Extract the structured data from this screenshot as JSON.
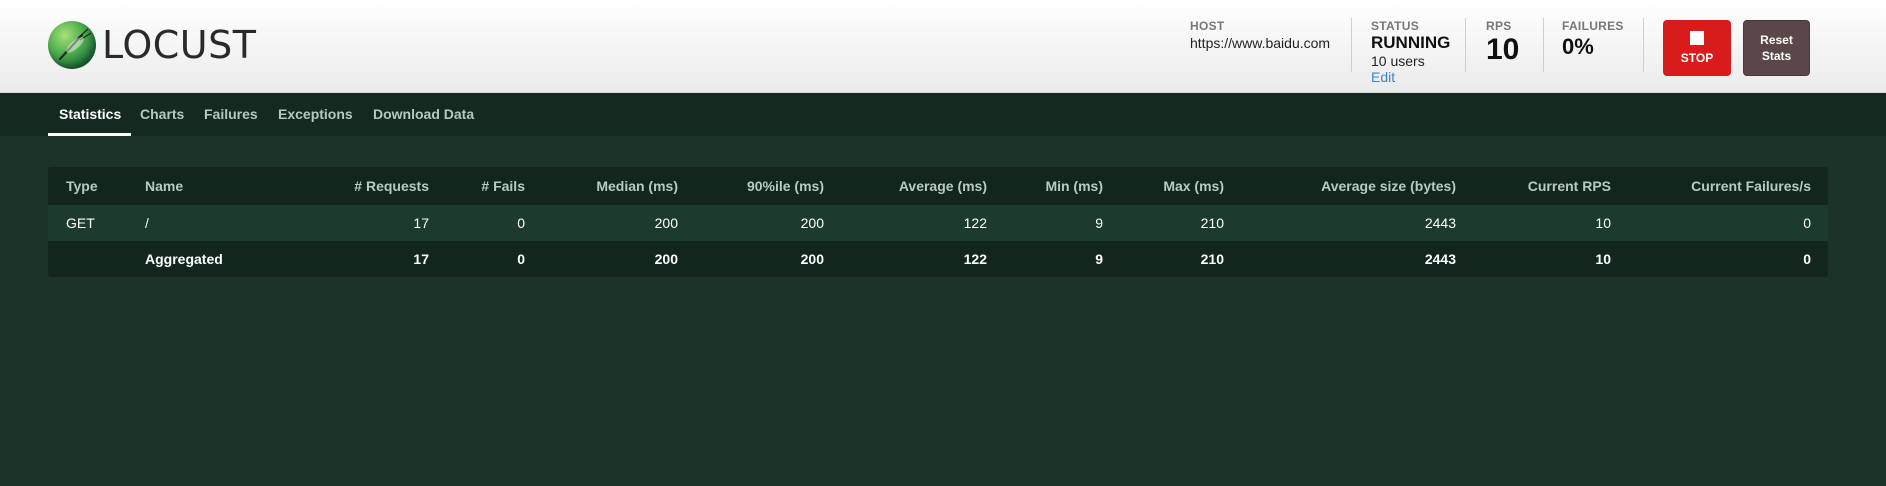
{
  "app": {
    "logo_text": "LOCUST"
  },
  "header": {
    "host": {
      "label": "HOST",
      "value": "https://www.baidu.com"
    },
    "status": {
      "label": "STATUS",
      "value": "RUNNING",
      "users": "10 users",
      "edit_label": "Edit"
    },
    "rps": {
      "label": "RPS",
      "value": "10"
    },
    "failures": {
      "label": "FAILURES",
      "value": "0%"
    },
    "stop_label": "STOP",
    "reset_label_line1": "Reset",
    "reset_label_line2": "Stats",
    "colors": {
      "stop": "#d81b1b",
      "reset": "#5b4747",
      "edit_link": "#3a86c8"
    }
  },
  "tabs": [
    {
      "label": "Statistics",
      "active": true
    },
    {
      "label": "Charts",
      "active": false
    },
    {
      "label": "Failures",
      "active": false
    },
    {
      "label": "Exceptions",
      "active": false
    },
    {
      "label": "Download Data",
      "active": false
    }
  ],
  "stats_table": {
    "columns": [
      "Type",
      "Name",
      "# Requests",
      "# Fails",
      "Median (ms)",
      "90%ile (ms)",
      "Average (ms)",
      "Min (ms)",
      "Max (ms)",
      "Average size (bytes)",
      "Current RPS",
      "Current Failures/s"
    ],
    "rows": [
      [
        "GET",
        "/",
        "17",
        "0",
        "200",
        "200",
        "122",
        "9",
        "210",
        "2443",
        "10",
        "0"
      ]
    ],
    "total": [
      "",
      "Aggregated",
      "17",
      "0",
      "200",
      "200",
      "122",
      "9",
      "210",
      "2443",
      "10",
      "0"
    ]
  }
}
